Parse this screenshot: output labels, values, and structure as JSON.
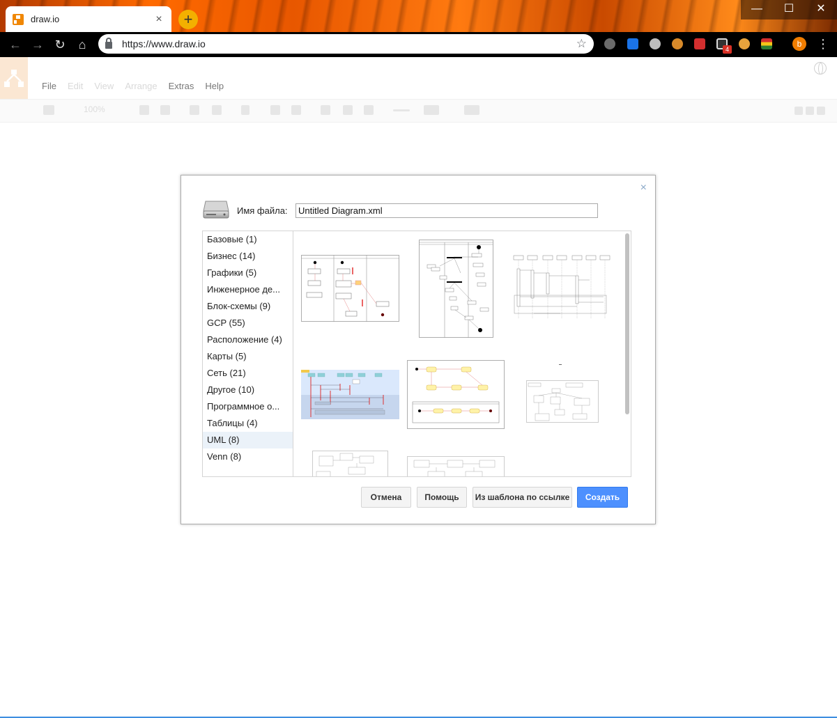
{
  "browser": {
    "tab_title": "draw.io",
    "tab_close": "×",
    "new_tab": "+",
    "url": "https://www.draw.io",
    "profile_initial": "b",
    "ext_badge": "4",
    "window_controls": {
      "minimize": "—",
      "maximize": "☐",
      "close": "✕"
    },
    "nav": {
      "back": "←",
      "forward": "→",
      "reload": "↻",
      "home": "⌂"
    }
  },
  "app": {
    "menu": [
      {
        "label": "File",
        "enabled": true
      },
      {
        "label": "Edit",
        "enabled": false
      },
      {
        "label": "View",
        "enabled": false
      },
      {
        "label": "Arrange",
        "enabled": false
      },
      {
        "label": "Extras",
        "enabled": true
      },
      {
        "label": "Help",
        "enabled": true
      }
    ],
    "zoom": "100%"
  },
  "dialog": {
    "close": "×",
    "filename_label": "Имя файла:",
    "filename_value": "Untitled Diagram.xml",
    "categories": [
      "Базовые (1)",
      "Бизнес (14)",
      "Графики (5)",
      "Инженерное де...",
      "Блок-схемы (9)",
      "GCP (55)",
      "Расположение (4)",
      "Карты (5)",
      "Сеть (21)",
      "Другое (10)",
      "Программное о...",
      "Таблицы (4)",
      "UML (8)",
      "Venn (8)"
    ],
    "selected_category": "UML (8)",
    "buttons": {
      "cancel": "Отмена",
      "help": "Помощь",
      "from_url": "Из шаблона по ссылке",
      "create": "Создать"
    }
  },
  "colors": {
    "primary_button": "#4d90fe",
    "selected_category_bg": "#ebf2f9",
    "drawio_orange": "#f08705"
  }
}
